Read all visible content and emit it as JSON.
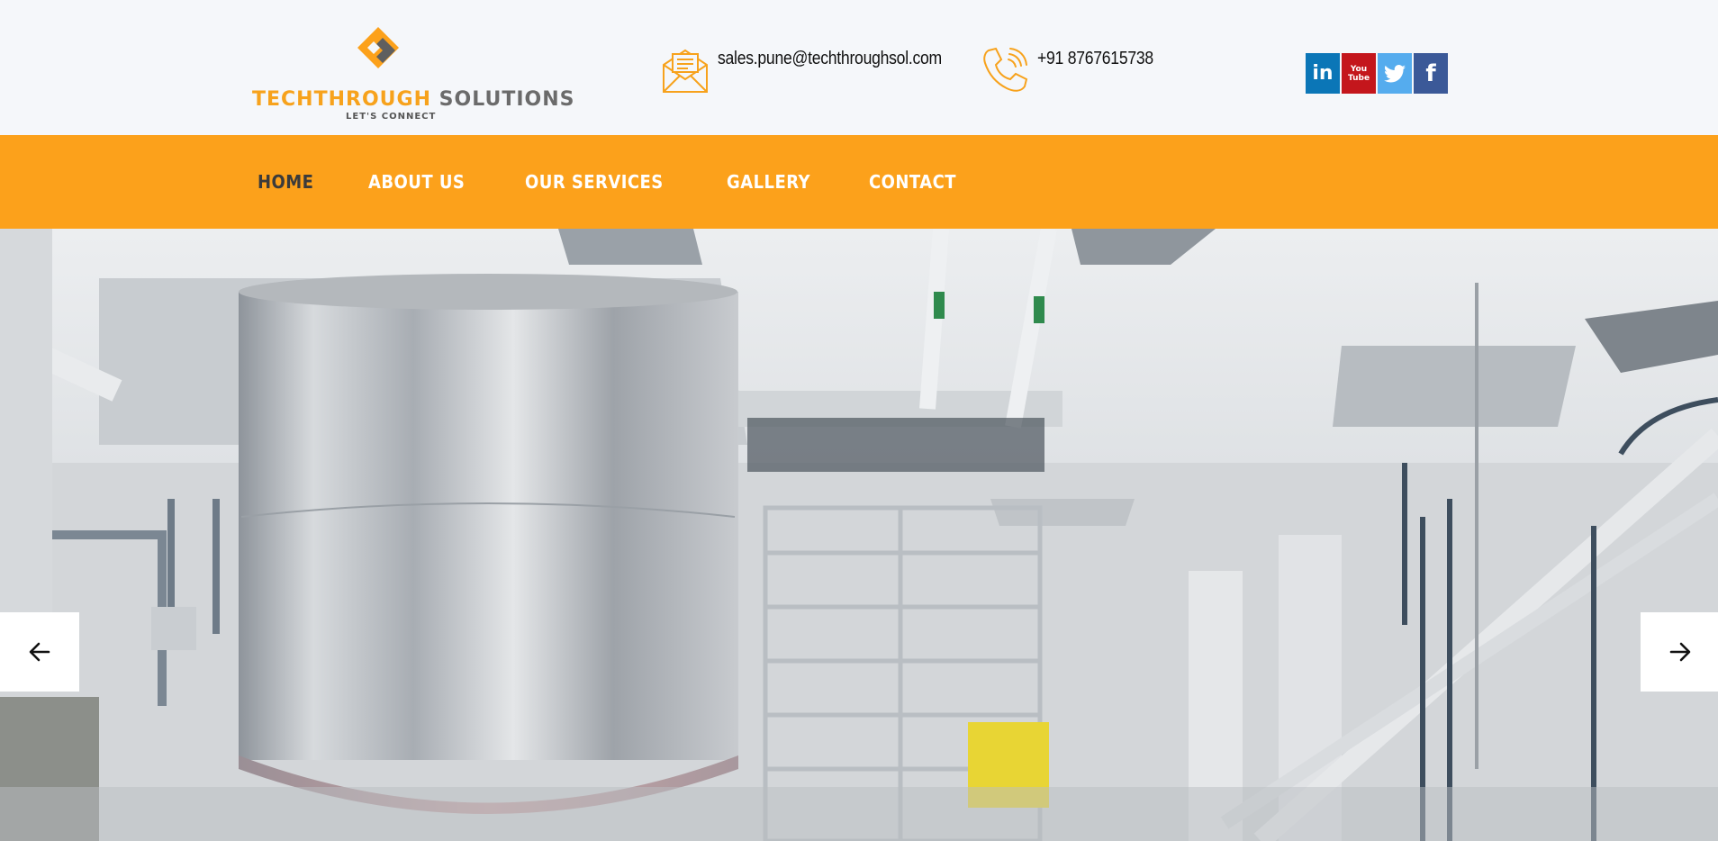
{
  "brand": {
    "name_part1": "TECHTHROUGH",
    "name_part2": "SOLUTIONS",
    "tagline": "LET'S CONNECT",
    "accent_color": "#fca11b",
    "grey_color": "#6b6b6b"
  },
  "contact": {
    "email": "sales.pune@techthroughsol.com",
    "email_icon": "envelope-icon",
    "phone": "+91 8767615738",
    "phone_icon": "phone-icon"
  },
  "social": [
    {
      "name": "linkedin",
      "label": "in",
      "color": "#0b76b7"
    },
    {
      "name": "youtube",
      "label": "You Tube",
      "color": "#c4161c"
    },
    {
      "name": "twitter",
      "label": "",
      "color": "#55acee"
    },
    {
      "name": "facebook",
      "label": "f",
      "color": "#3b5998"
    }
  ],
  "nav": {
    "items": [
      {
        "label": "HOME",
        "active": true
      },
      {
        "label": "ABOUT US",
        "active": false
      },
      {
        "label": "OUR SERVICES",
        "active": false
      },
      {
        "label": "GALLERY",
        "active": false
      },
      {
        "label": "CONTACT",
        "active": false
      }
    ]
  },
  "slider": {
    "prev_icon": "arrow-left-icon",
    "next_icon": "arrow-right-icon"
  }
}
